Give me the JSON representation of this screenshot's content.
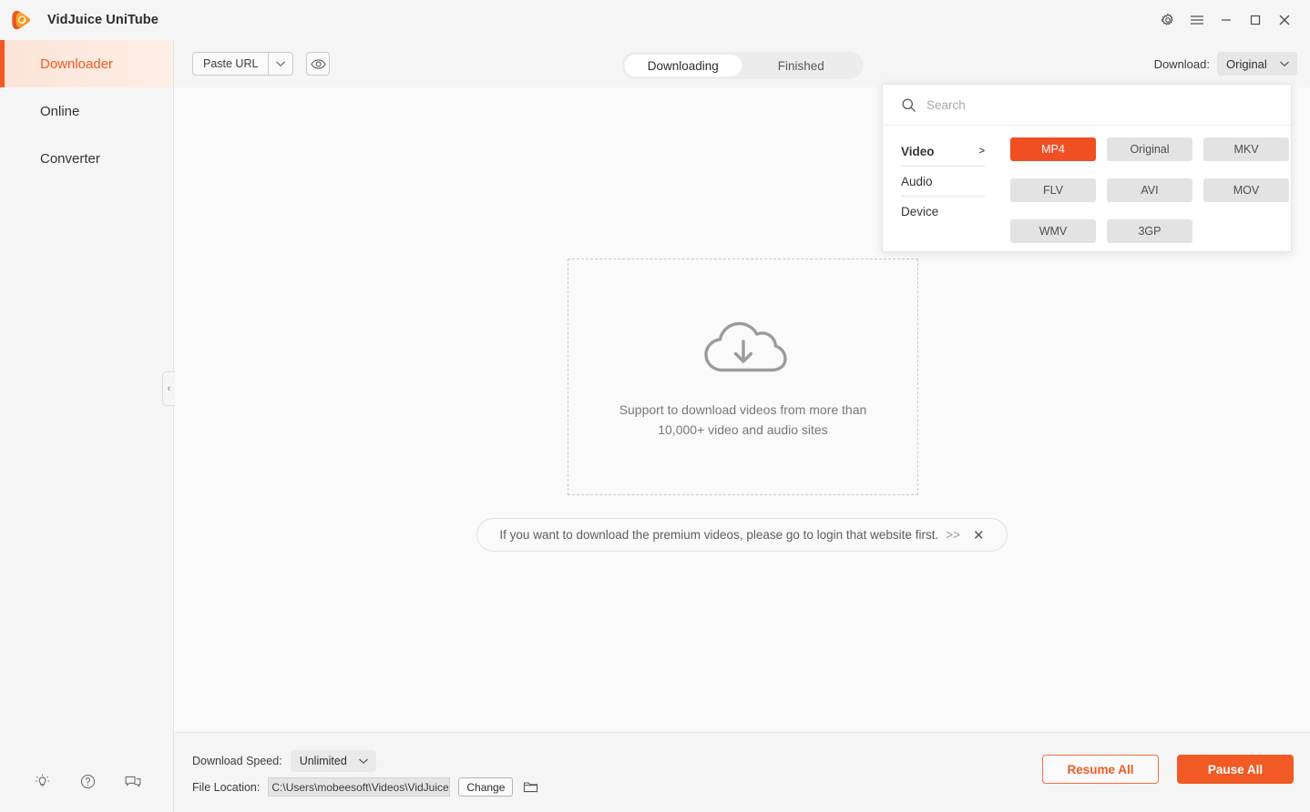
{
  "window": {
    "app_title": "VidJuice UniTube",
    "controls": [
      {
        "name": "settings-gear",
        "label": "Settings"
      },
      {
        "name": "menu",
        "label": "Menu"
      },
      {
        "name": "minimize",
        "label": "Minimize"
      },
      {
        "name": "maximize",
        "label": "Maximize"
      },
      {
        "name": "close",
        "label": "Close"
      }
    ]
  },
  "sidebar": {
    "items": [
      {
        "label": "Downloader",
        "active": true
      },
      {
        "label": "Online",
        "active": false
      },
      {
        "label": "Converter",
        "active": false
      }
    ],
    "bottom_icons": [
      {
        "name": "lightbulb-icon",
        "title": "Tips"
      },
      {
        "name": "help-icon",
        "title": "Help"
      },
      {
        "name": "feedback-icon",
        "title": "Feedback"
      }
    ],
    "collapse_glyph": "‹"
  },
  "toolbar": {
    "paste_url_label": "Paste URL",
    "paste_caret_glyph": "∨",
    "eye_icon_title": "Preview",
    "tabs": [
      {
        "label": "Downloading",
        "active": true
      },
      {
        "label": "Finished",
        "active": false
      }
    ],
    "download_label": "Download:",
    "download_value": "Original",
    "download_caret_glyph": "∨"
  },
  "format_panel": {
    "search_placeholder": "Search",
    "search_value": "",
    "categories": [
      {
        "label": "Video",
        "active": true,
        "arrow": ">"
      },
      {
        "label": "Audio",
        "active": false,
        "arrow": ""
      },
      {
        "label": "Device",
        "active": false,
        "arrow": ""
      }
    ],
    "formats": [
      {
        "label": "MP4",
        "selected": true
      },
      {
        "label": "Original",
        "selected": false
      },
      {
        "label": "MKV",
        "selected": false
      },
      {
        "label": "FLV",
        "selected": false
      },
      {
        "label": "AVI",
        "selected": false
      },
      {
        "label": "MOV",
        "selected": false
      },
      {
        "label": "WMV",
        "selected": false
      },
      {
        "label": "3GP",
        "selected": false
      }
    ]
  },
  "empty_state": {
    "icon": "cloud-download-icon",
    "line1": "Support to download videos from more than",
    "line2": "10,000+ video and audio sites"
  },
  "banner": {
    "message": "If you want to download the premium videos, please go to login that website first.",
    "link_glyph": ">>",
    "close_glyph": "✕"
  },
  "footer": {
    "speed_label": "Download Speed:",
    "speed_value": "Unlimited",
    "speed_caret_glyph": "∨",
    "location_label": "File Location:",
    "location_value": "C:\\Users\\mobeesoft\\Videos\\VidJuice",
    "change_label": "Change",
    "folder_icon": "folder-icon",
    "resume_all_label": "Resume All",
    "pause_all_label": "Pause All"
  },
  "colors": {
    "accent": "#f15a24",
    "accent_chip": "#f04e23",
    "sidebar_active_bg": "#fce4d7",
    "panel_bg": "#ffffff",
    "app_bg": "#fafafa",
    "chrome_bg": "#f5f5f5"
  }
}
